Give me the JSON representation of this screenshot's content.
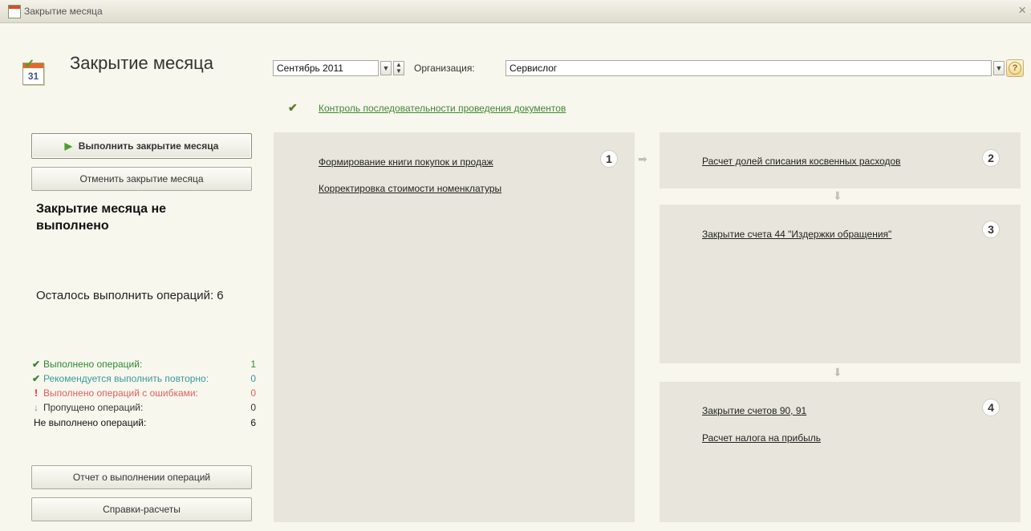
{
  "window": {
    "title": "Закрытие месяца",
    "close": "×"
  },
  "header": {
    "title": "Закрытие месяца",
    "calendar_day": "31",
    "period_value": "Сентябрь 2011",
    "org_label": "Организация:",
    "org_value": "Сервислог",
    "help": "?"
  },
  "control_link": "Контроль последовательности проведения документов",
  "actions": {
    "execute": "Выполнить закрытие месяца",
    "cancel": "Отменить закрытие месяца",
    "report": "Отчет о выполнении операций",
    "references": "Справки-расчеты"
  },
  "status": {
    "main": "Закрытие месяца не выполнено",
    "remaining": "Осталось выполнить операций: 6"
  },
  "stats": [
    {
      "label": "Выполнено операций:",
      "value": "1",
      "color": "#2f8a2f",
      "icon": "check-icon"
    },
    {
      "label": "Рекомендуется выполнить повторно:",
      "value": "0",
      "color": "#3a9a9a",
      "icon": "check-icon"
    },
    {
      "label": "Выполнено операций с ошибками:",
      "value": "0",
      "color": "#e06060",
      "icon": "exclamation-icon"
    },
    {
      "label": "Пропущено операций:",
      "value": "0",
      "color": "#333333",
      "icon": "down-arrow-icon"
    },
    {
      "label": "Не выполнено операций:",
      "value": "6",
      "color": "#111111",
      "icon": ""
    }
  ],
  "steps": {
    "s1": {
      "num": "1",
      "ops": [
        "Формирование книги покупок и продаж",
        "Корректировка стоимости номенклатуры"
      ]
    },
    "s2": {
      "num": "2",
      "ops": [
        "Расчет долей списания косвенных расходов"
      ]
    },
    "s3": {
      "num": "3",
      "ops": [
        "Закрытие счета 44 \"Издержки обращения\""
      ]
    },
    "s4": {
      "num": "4",
      "ops": [
        "Закрытие счетов 90, 91",
        "Расчет налога на прибыль"
      ]
    }
  },
  "colors": {
    "panel": "#e8e6dc",
    "accent_green": "#3c8a2e",
    "background": "#f8f7ee"
  }
}
